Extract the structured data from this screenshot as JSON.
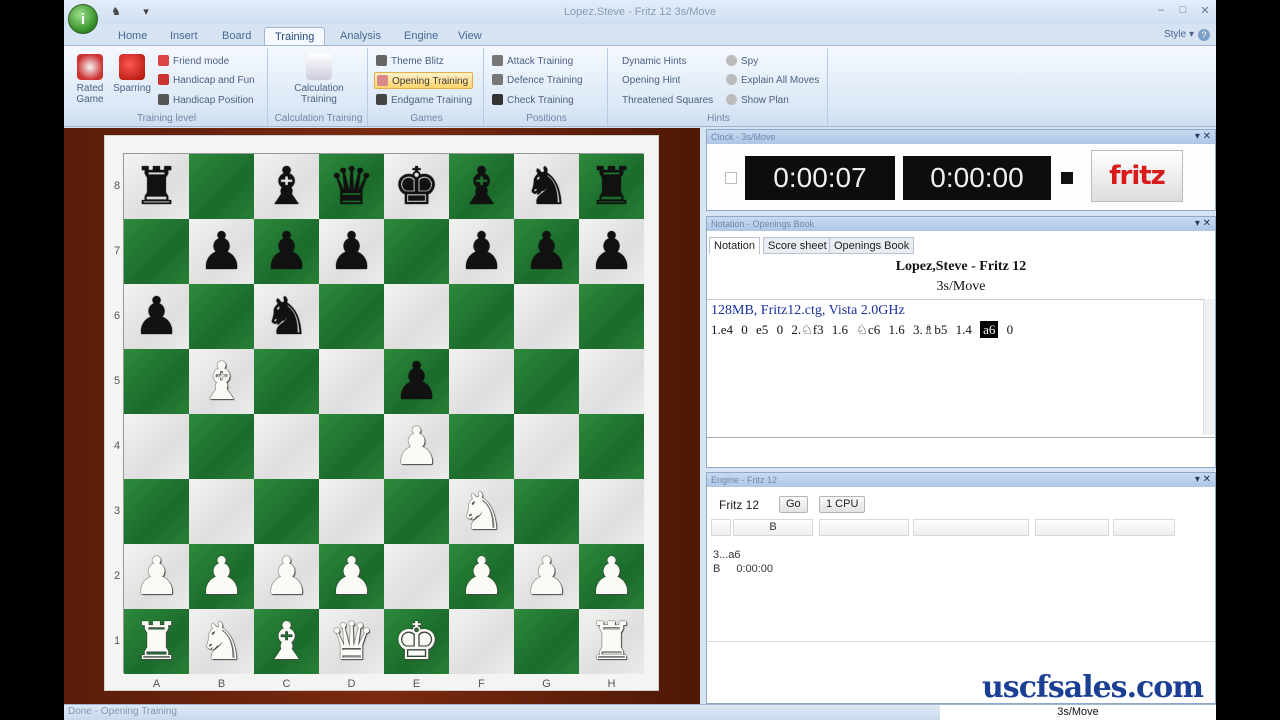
{
  "window": {
    "title": "Lopez,Steve - Fritz 12 3s/Move",
    "controls": [
      "–",
      "□",
      "✕"
    ],
    "orb_glyph": "i"
  },
  "tabs": [
    "Home",
    "Insert",
    "Board",
    "Training",
    "Analysis",
    "Engine",
    "View"
  ],
  "active_tab": "Training",
  "style_menu": "Style ▾",
  "ribbon": {
    "training_level": {
      "label": "Training level",
      "rated_game": "Rated Game",
      "sparring": "Sparring",
      "friend_mode": "Friend mode",
      "handicap_fun": "Handicap and Fun",
      "handicap_position": "Handicap Position"
    },
    "calculation_training": {
      "label": "Calculation Training",
      "button": "Calculation Training"
    },
    "games": {
      "label": "Games",
      "theme_blitz": "Theme Blitz",
      "opening_training": "Opening Training",
      "endgame_training": "Endgame Training"
    },
    "positions": {
      "label": "Positions",
      "attack_training": "Attack Training",
      "defence_training": "Defence Training",
      "check_training": "Check Training"
    },
    "hints": {
      "label": "Hints",
      "dynamic_hints": "Dynamic Hints",
      "opening_hint": "Opening Hint",
      "threatened_squares": "Threatened Squares",
      "spy": "Spy",
      "explain_all_moves": "Explain All Moves",
      "show_plan": "Show Plan"
    }
  },
  "board": {
    "ranks": [
      "8",
      "7",
      "6",
      "5",
      "4",
      "3",
      "2",
      "1"
    ],
    "files": [
      "A",
      "B",
      "C",
      "D",
      "E",
      "F",
      "G",
      "H"
    ],
    "position": [
      [
        "br",
        "",
        "bb",
        "bq",
        "bk",
        "bb",
        "bn",
        "br"
      ],
      [
        "",
        "bp",
        "bp",
        "bp",
        "",
        "bp",
        "bp",
        "bp"
      ],
      [
        "bp",
        "",
        "bn",
        "",
        "",
        "",
        "",
        ""
      ],
      [
        "",
        "wb",
        "",
        "",
        "bp",
        "",
        "",
        ""
      ],
      [
        "",
        "",
        "",
        "",
        "wp",
        "",
        "",
        ""
      ],
      [
        "",
        "",
        "",
        "",
        "",
        "wn",
        "",
        ""
      ],
      [
        "wp",
        "wp",
        "wp",
        "wp",
        "",
        "wp",
        "wp",
        "wp"
      ],
      [
        "wr",
        "wn",
        "wb",
        "wq",
        "wk",
        "",
        "",
        "wr"
      ]
    ]
  },
  "clock_panel": {
    "title": "Clock - 3s/Move",
    "white_time": "0:00:07",
    "black_time": "0:00:00",
    "logo": "fritz"
  },
  "notation_panel": {
    "title": "Notation - Openings Book",
    "tabs": [
      "Notation",
      "Score sheet",
      "Openings Book"
    ],
    "players": "Lopez,Steve - Fritz 12",
    "time_control": "3s/Move",
    "db_info": "128MB, Fritz12.ctg, Vista 2.0GHz",
    "moves": [
      "1.e4",
      "0",
      "e5",
      "0",
      "2.♘f3",
      "1.6",
      "♘c6",
      "1.6",
      "3.♗b5",
      "1.4"
    ],
    "current_move": "a6",
    "current_eval": "0"
  },
  "engine_panel": {
    "title": "Engine - Fritz 12",
    "engine_name": "Fritz 12",
    "go_button": "Go",
    "cpu_button": "1 CPU",
    "side": "B",
    "line1": "3...a6",
    "line2_side": "B",
    "line2_time": "0:00:00"
  },
  "status_bar": {
    "left": "Done - Opening Training",
    "right": "3s/Move"
  },
  "watermark": "uscfsales.com",
  "colors": {
    "dark_square": "#1b6b2b",
    "light_square": "#e6e6e4",
    "ribbon_bg": "#dde9f7",
    "board_bg": "#5a1d0a"
  }
}
